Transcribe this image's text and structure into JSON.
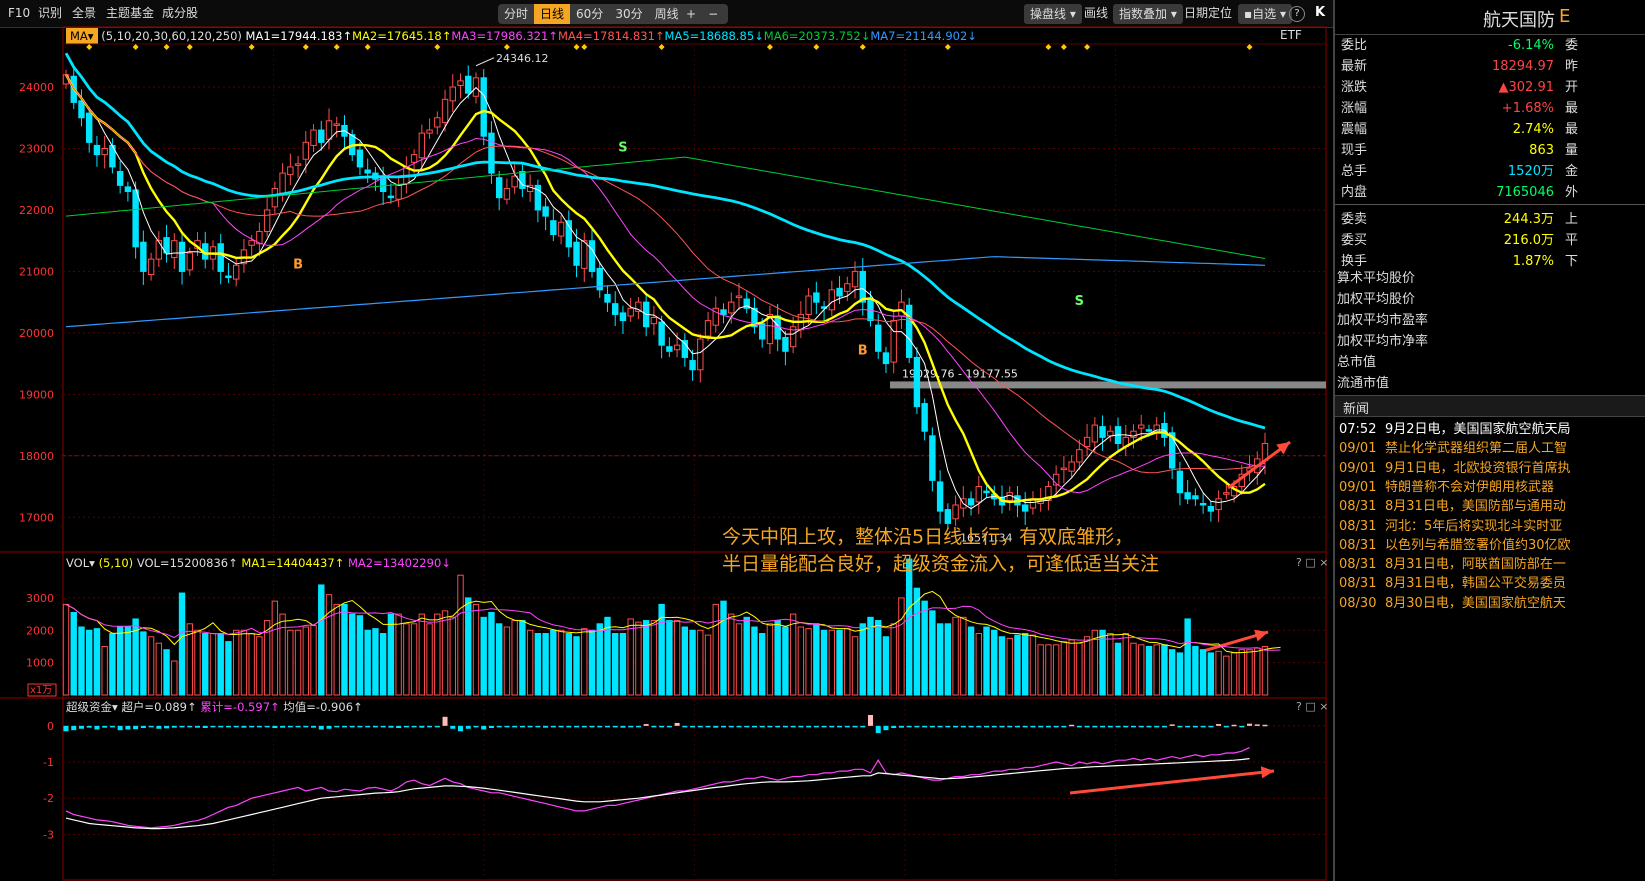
{
  "toolbar": {
    "f10": "F10",
    "identify": "识别",
    "full_view": "全景",
    "theme_fund": "主题基金",
    "components": "成分股",
    "periods": [
      "分时",
      "日线",
      "60分",
      "30分",
      "周线"
    ],
    "active_period": "日线",
    "plus": "+",
    "minus": "−",
    "operate_line": "操盘线",
    "draw_line": "画线",
    "index_overlay": "指数叠加",
    "date_locate": "日期定位",
    "self_select": "自选",
    "help": "?",
    "collapse": "K"
  },
  "main_legend": {
    "indicator": "MA",
    "params": "(5,10,20,30,60,120,250)",
    "ma_values": [
      {
        "text": "MA1=17944.183↑",
        "color": "#ffffff"
      },
      {
        "text": "MA2=17645.18↑",
        "color": "#ffff00"
      },
      {
        "text": "MA3=17986.321↑",
        "color": "#ff44ff"
      },
      {
        "text": "MA4=17814.831↑",
        "color": "#ff5555"
      },
      {
        "text": "MA5=18688.85↓",
        "color": "#00e5ff"
      },
      {
        "text": "MA6=20373.752↓",
        "color": "#00cc33"
      },
      {
        "text": "MA7=21144.902↓",
        "color": "#3399ff"
      }
    ],
    "etf": "ETF"
  },
  "annotation": {
    "line1": "今天中阳上攻，整体沿5日线上行，有双底雏形，",
    "line2": "半日量能配合良好，超级资金流入，可逢低适当关注"
  },
  "vol_legend": {
    "name": "VOL",
    "params": "(5,10)",
    "vol": "VOL=15200836↑",
    "ma1": "MA1=14404437↑",
    "ma2": "MA2=13402290↓",
    "unit": "x1万"
  },
  "fund_legend": {
    "name": "超级资金",
    "super": "超户=0.089↑",
    "cumulative": "累计=-0.597↑",
    "avg": "均值=-0.906↑"
  },
  "panel_controls": "? □ ×",
  "chart_data": [
    {
      "type": "candlestick",
      "title": "",
      "ylim": [
        16500,
        24700
      ],
      "yticks": [
        17000,
        18000,
        19000,
        20000,
        21000,
        22000,
        23000,
        24000
      ],
      "ylabels": [
        "17000",
        "18000",
        "19000",
        "20000",
        "21000",
        "22000",
        "23000",
        "24000"
      ],
      "grid": true,
      "high_label": "24346.12",
      "range_label": "19029.76 - 19177.55",
      "range_band": [
        19029.76,
        19177.55
      ],
      "low_label": "16571.34",
      "reference_price": 18000,
      "signals": [
        {
          "label": "B",
          "x": 30,
          "y": 21050
        },
        {
          "label": "S",
          "x": 72,
          "y": 22950
        },
        {
          "label": "B",
          "x": 103,
          "y": 19650
        },
        {
          "label": "S",
          "x": 131,
          "y": 20450
        }
      ],
      "close": [
        24200,
        23750,
        23500,
        23100,
        22900,
        23000,
        22700,
        22400,
        22300,
        21400,
        21000,
        21200,
        21500,
        21300,
        21500,
        21000,
        21300,
        21500,
        21200,
        21400,
        21000,
        20900,
        21100,
        21350,
        21500,
        21650,
        22000,
        22350,
        22600,
        22700,
        22750,
        23100,
        23300,
        23100,
        23450,
        23400,
        23200,
        22900,
        22700,
        22600,
        22500,
        22300,
        22200,
        22400,
        22700,
        22900,
        23250,
        23300,
        23500,
        23800,
        24000,
        24100,
        23900,
        24150,
        23200,
        22600,
        22200,
        22350,
        22550,
        22350,
        22400,
        22000,
        21900,
        21600,
        21800,
        21400,
        21100,
        21500,
        21000,
        20700,
        20500,
        20300,
        20200,
        20400,
        20500,
        20100,
        20250,
        19800,
        19700,
        19800,
        19600,
        19400,
        19900,
        20200,
        20400,
        20300,
        20500,
        20600,
        20400,
        20100,
        19900,
        20300,
        19900,
        19700,
        20100,
        20300,
        20600,
        20500,
        20400,
        20700,
        20600,
        20800,
        21000,
        20500,
        20200,
        19700,
        19500,
        20200,
        20500,
        19600,
        18800,
        18400,
        17600,
        17100,
        16900,
        17200,
        17300,
        17200,
        17500,
        17400,
        17300,
        17200,
        17400,
        17200,
        17100,
        17300,
        17300,
        17500,
        17700,
        17800,
        17900,
        18100,
        18300,
        18500,
        18300,
        18400,
        18200,
        18300,
        18400,
        18500,
        18400,
        18500,
        18300,
        17800,
        17400,
        17300,
        17300,
        17200,
        17100,
        17300,
        17400,
        17500,
        17700,
        17800,
        17950,
        18200
      ],
      "annotation_arrow": "up-right"
    },
    {
      "type": "bar",
      "title": "",
      "ylim": [
        0,
        3800
      ],
      "yticks": [
        1000,
        2000,
        3000
      ],
      "ylabels": [
        "1000",
        "2000",
        "3000"
      ],
      "unit_label": "x1万",
      "values": [
        2800,
        2550,
        2100,
        2000,
        2050,
        1500,
        1900,
        2100,
        2100,
        2350,
        1950,
        1800,
        1600,
        1400,
        1050,
        3150,
        2200,
        2000,
        1900,
        1900,
        1900,
        1650,
        2000,
        2000,
        1900,
        1800,
        2300,
        2900,
        2500,
        2000,
        2000,
        2100,
        2150,
        3400,
        3100,
        2800,
        2800,
        2500,
        2450,
        2000,
        2050,
        1900,
        2500,
        2500,
        2200,
        2200,
        2500,
        2200,
        2500,
        2600,
        2400,
        3700,
        3000,
        2800,
        2400,
        2550,
        2200,
        2100,
        2300,
        2300,
        2000,
        1900,
        1900,
        2000,
        2000,
        1900,
        1800,
        2050,
        2000,
        2200,
        2400,
        1900,
        1900,
        2350,
        2250,
        2300,
        2300,
        2800,
        2300,
        2300,
        2100,
        2000,
        2000,
        1850,
        2800,
        2900,
        2500,
        2200,
        2400,
        2100,
        1900,
        2200,
        2300,
        2100,
        2500,
        2100,
        2050,
        2200,
        2000,
        2000,
        2000,
        2050,
        1800,
        2200,
        2400,
        2300,
        1800,
        2200,
        3000,
        4200,
        3300,
        2900,
        2600,
        2200,
        2200,
        2400,
        2400,
        2100,
        1900,
        2100,
        2000,
        1800,
        1750,
        1850,
        1900,
        1850,
        1550,
        1550,
        1550,
        1650,
        1700,
        1600,
        1800,
        2000,
        2000,
        1900,
        1600,
        1900,
        1600,
        1550,
        1500,
        1550,
        1550,
        1400,
        1300,
        2350,
        1500,
        1400,
        1300,
        1350,
        1200,
        1300,
        1400,
        1400,
        1450,
        1500,
        1500,
        1500
      ],
      "ma5_label": "MA1",
      "ma10_label": "MA2"
    },
    {
      "type": "line",
      "title": "",
      "ylim": [
        -3.1,
        0.3
      ],
      "yticks": [
        0,
        -1,
        -2,
        -3
      ],
      "ylabels": [
        "0",
        "-1",
        "-2",
        "-3"
      ],
      "super_bars": [
        -0.15,
        -0.12,
        -0.08,
        -0.05,
        -0.1,
        -0.05,
        -0.03,
        -0.12,
        -0.1,
        -0.09,
        -0.06,
        -0.04,
        -0.08,
        -0.07,
        -0.05,
        -0.04,
        -0.03,
        -0.05,
        -0.06,
        -0.04,
        -0.03,
        -0.02,
        -0.04,
        -0.05,
        -0.03,
        -0.02,
        -0.04,
        -0.06,
        -0.05,
        -0.03,
        -0.02,
        -0.03,
        -0.05,
        -0.1,
        -0.08,
        -0.04,
        -0.03,
        -0.02,
        -0.02,
        -0.03,
        -0.02,
        -0.04,
        -0.05,
        -0.06,
        -0.04,
        -0.03,
        -0.05,
        -0.04,
        -0.02,
        0.25,
        -0.08,
        -0.15,
        -0.08,
        -0.04,
        -0.1,
        -0.06,
        -0.03,
        -0.02,
        -0.02,
        -0.03,
        -0.02,
        -0.03,
        -0.05,
        -0.04,
        -0.03,
        -0.02,
        -0.04,
        -0.03,
        -0.02,
        -0.02,
        -0.04,
        -0.03,
        -0.05,
        -0.04,
        -0.02,
        0.05,
        -0.03,
        -0.02,
        -0.03,
        0.08,
        -0.04,
        -0.03,
        -0.02,
        -0.02,
        -0.05,
        -0.03,
        -0.04,
        -0.02,
        -0.03,
        -0.02,
        -0.04,
        -0.02,
        -0.02,
        -0.03,
        -0.02,
        -0.03,
        -0.02,
        -0.03,
        -0.04,
        -0.03,
        -0.02,
        -0.02,
        -0.03,
        -0.02,
        0.3,
        -0.2,
        -0.12,
        -0.06,
        -0.05,
        -0.04,
        -0.03,
        -0.02,
        -0.03,
        -0.03,
        -0.02,
        -0.03,
        -0.02,
        -0.02,
        -0.03,
        -0.02,
        -0.03,
        -0.02,
        -0.03,
        -0.02,
        -0.02,
        -0.03,
        -0.04,
        -0.02,
        -0.03,
        -0.02,
        0.03,
        -0.02,
        -0.03,
        -0.02,
        -0.03,
        -0.02,
        -0.02,
        -0.03,
        -0.02,
        -0.03,
        -0.02,
        -0.02,
        -0.03,
        0.04,
        -0.02,
        -0.03,
        -0.02,
        -0.02,
        -0.03,
        0.05,
        -0.02,
        0.03,
        -0.02,
        0.06,
        0.04,
        0.03,
        0.06,
        0.09
      ],
      "cumulative": [
        -2.35,
        -2.45,
        -2.5,
        -2.55,
        -2.6,
        -2.62,
        -2.65,
        -2.7,
        -2.75,
        -2.78,
        -2.8,
        -2.82,
        -2.8,
        -2.78,
        -2.75,
        -2.7,
        -2.65,
        -2.62,
        -2.55,
        -2.45,
        -2.35,
        -2.25,
        -2.2,
        -2.1,
        -2.0,
        -1.95,
        -1.9,
        -1.85,
        -1.8,
        -1.75,
        -1.7,
        -1.8,
        -1.75,
        -1.7,
        -1.8,
        -1.82,
        -1.75,
        -1.78,
        -1.8,
        -1.72,
        -1.7,
        -1.75,
        -1.8,
        -1.7,
        -1.55,
        -1.5,
        -1.6,
        -1.65,
        -1.55,
        -1.45,
        -1.55,
        -1.6,
        -1.7,
        -1.75,
        -1.8,
        -1.85,
        -1.85,
        -1.9,
        -1.95,
        -2.0,
        -2.05,
        -2.1,
        -2.15,
        -2.2,
        -2.25,
        -2.3,
        -2.35,
        -2.35,
        -2.3,
        -2.25,
        -2.2,
        -2.2,
        -2.15,
        -2.1,
        -2.05,
        -2.0,
        -1.95,
        -1.9,
        -1.85,
        -1.8,
        -1.8,
        -1.75,
        -1.7,
        -1.65,
        -1.6,
        -1.55,
        -1.55,
        -1.5,
        -1.45,
        -1.45,
        -1.4,
        -1.45,
        -1.5,
        -1.45,
        -1.4,
        -1.4,
        -1.35,
        -1.35,
        -1.3,
        -1.3,
        -1.25,
        -1.25,
        -1.2,
        -1.2,
        -1.3,
        -0.95,
        -1.3,
        -1.35,
        -1.3,
        -1.35,
        -1.4,
        -1.45,
        -1.5,
        -1.5,
        -1.45,
        -1.4,
        -1.4,
        -1.35,
        -1.35,
        -1.3,
        -1.25,
        -1.25,
        -1.2,
        -1.2,
        -1.15,
        -1.15,
        -1.1,
        -1.05,
        -1.0,
        -1.05,
        -1.1,
        -1.0,
        -1.05,
        -1.0,
        -1.05,
        -1.0,
        -0.95,
        -0.95,
        -0.9,
        -0.95,
        -0.9,
        -0.95,
        -0.9,
        -0.85,
        -0.9,
        -0.85,
        -0.8,
        -0.85,
        -0.8,
        -0.8,
        -0.75,
        -0.75,
        -0.7,
        -0.6
      ],
      "average": [
        -2.55,
        -2.6,
        -2.65,
        -2.7,
        -2.72,
        -2.74,
        -2.76,
        -2.78,
        -2.8,
        -2.82,
        -2.83,
        -2.84,
        -2.84,
        -2.83,
        -2.82,
        -2.8,
        -2.78,
        -2.76,
        -2.73,
        -2.7,
        -2.65,
        -2.6,
        -2.55,
        -2.5,
        -2.45,
        -2.4,
        -2.35,
        -2.3,
        -2.25,
        -2.2,
        -2.15,
        -2.1,
        -2.05,
        -2.0,
        -1.98,
        -1.96,
        -1.94,
        -1.92,
        -1.9,
        -1.88,
        -1.86,
        -1.85,
        -1.84,
        -1.82,
        -1.78,
        -1.74,
        -1.72,
        -1.7,
        -1.68,
        -1.66,
        -1.66,
        -1.67,
        -1.68,
        -1.7,
        -1.72,
        -1.75,
        -1.78,
        -1.81,
        -1.84,
        -1.87,
        -1.9,
        -1.93,
        -1.96,
        -1.99,
        -2.02,
        -2.05,
        -2.08,
        -2.1,
        -2.1,
        -2.1,
        -2.08,
        -2.06,
        -2.04,
        -2.02,
        -2.0,
        -1.97,
        -1.94,
        -1.91,
        -1.88,
        -1.85,
        -1.82,
        -1.79,
        -1.76,
        -1.73,
        -1.7,
        -1.68,
        -1.65,
        -1.62,
        -1.6,
        -1.58,
        -1.56,
        -1.55,
        -1.55,
        -1.55,
        -1.54,
        -1.53,
        -1.52,
        -1.5,
        -1.48,
        -1.46,
        -1.44,
        -1.42,
        -1.4,
        -1.38,
        -1.38,
        -1.3,
        -1.32,
        -1.34,
        -1.36,
        -1.38,
        -1.4,
        -1.42,
        -1.44,
        -1.46,
        -1.46,
        -1.45,
        -1.44,
        -1.42,
        -1.4,
        -1.38,
        -1.36,
        -1.34,
        -1.32,
        -1.3,
        -1.28,
        -1.26,
        -1.24,
        -1.22,
        -1.2,
        -1.18,
        -1.17,
        -1.16,
        -1.14,
        -1.13,
        -1.12,
        -1.11,
        -1.1,
        -1.09,
        -1.08,
        -1.07,
        -1.06,
        -1.05,
        -1.04,
        -1.03,
        -1.02,
        -1.01,
        -1.0,
        -0.99,
        -0.98,
        -0.97,
        -0.96,
        -0.95,
        -0.93,
        -0.906
      ]
    }
  ],
  "right_panel": {
    "stock_name": "航天国防",
    "stock_suffix": "E",
    "quotes": [
      {
        "k": "委比",
        "v": "-6.14%",
        "color": "#00ff66",
        "x": "委"
      },
      {
        "k": "最新",
        "v": "18294.97",
        "color": "#ff4444",
        "x": "昨"
      },
      {
        "k": "涨跌",
        "v": "▲302.91",
        "color": "#ff4444",
        "x": "开"
      },
      {
        "k": "涨幅",
        "v": "+1.68%",
        "color": "#ff4444",
        "x": "最"
      },
      {
        "k": "震幅",
        "v": "2.74%",
        "color": "#ffff00",
        "x": "最"
      },
      {
        "k": "现手",
        "v": "863",
        "color": "#ffff00",
        "x": "量"
      },
      {
        "k": "总手",
        "v": "1520万",
        "color": "#00e5ff",
        "x": "金"
      },
      {
        "k": "内盘",
        "v": "7165046",
        "color": "#00ff66",
        "x": "外"
      },
      {
        "k": "委卖",
        "v": "244.3万",
        "color": "#ffff00",
        "x": "上"
      },
      {
        "k": "委买",
        "v": "216.0万",
        "color": "#ffff00",
        "x": "平"
      },
      {
        "k": "换手",
        "v": "1.87%",
        "color": "#ffff00",
        "x": "下"
      }
    ],
    "stats": [
      "算术平均股价",
      "加权平均股价",
      "加权平均市盈率",
      "加权平均市净率",
      "总市值",
      "流通市值"
    ],
    "news_title": "新闻",
    "news": [
      {
        "d": "07:52",
        "t": "9月2日电，美国国家航空航天局",
        "dcolor": "#ffffff",
        "tcolor": "#ffffff"
      },
      {
        "d": "09/01",
        "t": "禁止化学武器组织第二届人工智",
        "dcolor": "#f5a623",
        "tcolor": "#f5a623"
      },
      {
        "d": "09/01",
        "t": "9月1日电，北欧投资银行首席执",
        "dcolor": "#f5a623",
        "tcolor": "#f5a623"
      },
      {
        "d": "09/01",
        "t": "特朗普称不会对伊朗用核武器",
        "dcolor": "#f5a623",
        "tcolor": "#f5a623"
      },
      {
        "d": "08/31",
        "t": "8月31日电，美国防部与通用动",
        "dcolor": "#f5a623",
        "tcolor": "#f5a623"
      },
      {
        "d": "08/31",
        "t": "河北：5年后将实现北斗实时亚",
        "dcolor": "#f5a623",
        "tcolor": "#f5a623"
      },
      {
        "d": "08/31",
        "t": "以色列与希腊签署价值约30亿欧",
        "dcolor": "#f5a623",
        "tcolor": "#f5a623"
      },
      {
        "d": "08/31",
        "t": "8月31日电，阿联酋国防部在一",
        "dcolor": "#f5a623",
        "tcolor": "#f5a623"
      },
      {
        "d": "08/31",
        "t": "8月31日电，韩国公平交易委员",
        "dcolor": "#f5a623",
        "tcolor": "#f5a623"
      },
      {
        "d": "08/30",
        "t": "8月30日电，美国国家航空航天",
        "dcolor": "#f5a623",
        "tcolor": "#f5a623"
      }
    ]
  }
}
